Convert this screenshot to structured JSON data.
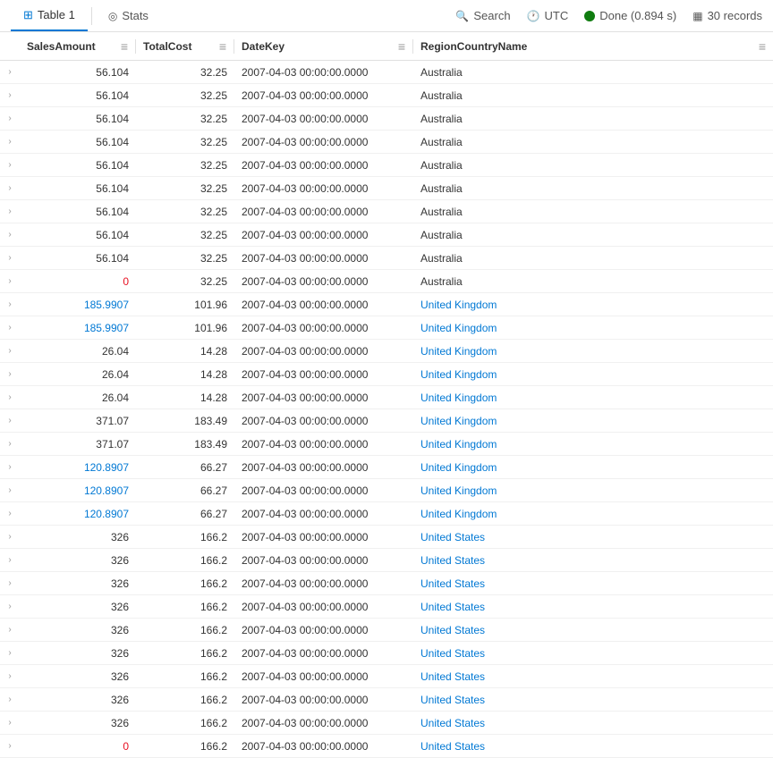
{
  "topbar": {
    "tab1_label": "Table 1",
    "tab2_label": "Stats",
    "search_label": "Search",
    "utc_label": "UTC",
    "done_label": "Done (0.894 s)",
    "records_label": "30 records"
  },
  "columns": {
    "col1": "SalesAmount",
    "col2": "TotalCost",
    "col3": "DateKey",
    "col4": "RegionCountryName"
  },
  "rows": [
    {
      "sales": "56.104",
      "cost": "32.25",
      "date": "2007-04-03 00:00:00.0000",
      "region": "Australia",
      "sales_class": "val-default",
      "region_class": "region-australia"
    },
    {
      "sales": "56.104",
      "cost": "32.25",
      "date": "2007-04-03 00:00:00.0000",
      "region": "Australia",
      "sales_class": "val-default",
      "region_class": "region-australia"
    },
    {
      "sales": "56.104",
      "cost": "32.25",
      "date": "2007-04-03 00:00:00.0000",
      "region": "Australia",
      "sales_class": "val-default",
      "region_class": "region-australia"
    },
    {
      "sales": "56.104",
      "cost": "32.25",
      "date": "2007-04-03 00:00:00.0000",
      "region": "Australia",
      "sales_class": "val-default",
      "region_class": "region-australia"
    },
    {
      "sales": "56.104",
      "cost": "32.25",
      "date": "2007-04-03 00:00:00.0000",
      "region": "Australia",
      "sales_class": "val-default",
      "region_class": "region-australia"
    },
    {
      "sales": "56.104",
      "cost": "32.25",
      "date": "2007-04-03 00:00:00.0000",
      "region": "Australia",
      "sales_class": "val-default",
      "region_class": "region-australia"
    },
    {
      "sales": "56.104",
      "cost": "32.25",
      "date": "2007-04-03 00:00:00.0000",
      "region": "Australia",
      "sales_class": "val-default",
      "region_class": "region-australia"
    },
    {
      "sales": "56.104",
      "cost": "32.25",
      "date": "2007-04-03 00:00:00.0000",
      "region": "Australia",
      "sales_class": "val-default",
      "region_class": "region-australia"
    },
    {
      "sales": "56.104",
      "cost": "32.25",
      "date": "2007-04-03 00:00:00.0000",
      "region": "Australia",
      "sales_class": "val-default",
      "region_class": "region-australia"
    },
    {
      "sales": "0",
      "cost": "32.25",
      "date": "2007-04-03 00:00:00.0000",
      "region": "Australia",
      "sales_class": "val-red",
      "region_class": "region-australia"
    },
    {
      "sales": "185.9907",
      "cost": "101.96",
      "date": "2007-04-03 00:00:00.0000",
      "region": "United Kingdom",
      "sales_class": "val-blue",
      "region_class": "region-uk"
    },
    {
      "sales": "185.9907",
      "cost": "101.96",
      "date": "2007-04-03 00:00:00.0000",
      "region": "United Kingdom",
      "sales_class": "val-blue",
      "region_class": "region-uk"
    },
    {
      "sales": "26.04",
      "cost": "14.28",
      "date": "2007-04-03 00:00:00.0000",
      "region": "United Kingdom",
      "sales_class": "val-default",
      "region_class": "region-uk"
    },
    {
      "sales": "26.04",
      "cost": "14.28",
      "date": "2007-04-03 00:00:00.0000",
      "region": "United Kingdom",
      "sales_class": "val-default",
      "region_class": "region-uk"
    },
    {
      "sales": "26.04",
      "cost": "14.28",
      "date": "2007-04-03 00:00:00.0000",
      "region": "United Kingdom",
      "sales_class": "val-default",
      "region_class": "region-uk"
    },
    {
      "sales": "371.07",
      "cost": "183.49",
      "date": "2007-04-03 00:00:00.0000",
      "region": "United Kingdom",
      "sales_class": "val-default",
      "region_class": "region-uk"
    },
    {
      "sales": "371.07",
      "cost": "183.49",
      "date": "2007-04-03 00:00:00.0000",
      "region": "United Kingdom",
      "sales_class": "val-default",
      "region_class": "region-uk"
    },
    {
      "sales": "120.8907",
      "cost": "66.27",
      "date": "2007-04-03 00:00:00.0000",
      "region": "United Kingdom",
      "sales_class": "val-blue",
      "region_class": "region-uk"
    },
    {
      "sales": "120.8907",
      "cost": "66.27",
      "date": "2007-04-03 00:00:00.0000",
      "region": "United Kingdom",
      "sales_class": "val-blue",
      "region_class": "region-uk"
    },
    {
      "sales": "120.8907",
      "cost": "66.27",
      "date": "2007-04-03 00:00:00.0000",
      "region": "United Kingdom",
      "sales_class": "val-blue",
      "region_class": "region-uk"
    },
    {
      "sales": "326",
      "cost": "166.2",
      "date": "2007-04-03 00:00:00.0000",
      "region": "United States",
      "sales_class": "val-default",
      "region_class": "region-us"
    },
    {
      "sales": "326",
      "cost": "166.2",
      "date": "2007-04-03 00:00:00.0000",
      "region": "United States",
      "sales_class": "val-default",
      "region_class": "region-us"
    },
    {
      "sales": "326",
      "cost": "166.2",
      "date": "2007-04-03 00:00:00.0000",
      "region": "United States",
      "sales_class": "val-default",
      "region_class": "region-us"
    },
    {
      "sales": "326",
      "cost": "166.2",
      "date": "2007-04-03 00:00:00.0000",
      "region": "United States",
      "sales_class": "val-default",
      "region_class": "region-us"
    },
    {
      "sales": "326",
      "cost": "166.2",
      "date": "2007-04-03 00:00:00.0000",
      "region": "United States",
      "sales_class": "val-default",
      "region_class": "region-us"
    },
    {
      "sales": "326",
      "cost": "166.2",
      "date": "2007-04-03 00:00:00.0000",
      "region": "United States",
      "sales_class": "val-default",
      "region_class": "region-us"
    },
    {
      "sales": "326",
      "cost": "166.2",
      "date": "2007-04-03 00:00:00.0000",
      "region": "United States",
      "sales_class": "val-default",
      "region_class": "region-us"
    },
    {
      "sales": "326",
      "cost": "166.2",
      "date": "2007-04-03 00:00:00.0000",
      "region": "United States",
      "sales_class": "val-default",
      "region_class": "region-us"
    },
    {
      "sales": "326",
      "cost": "166.2",
      "date": "2007-04-03 00:00:00.0000",
      "region": "United States",
      "sales_class": "val-default",
      "region_class": "region-us"
    },
    {
      "sales": "0",
      "cost": "166.2",
      "date": "2007-04-03 00:00:00.0000",
      "region": "United States",
      "sales_class": "val-red",
      "region_class": "region-us"
    }
  ]
}
